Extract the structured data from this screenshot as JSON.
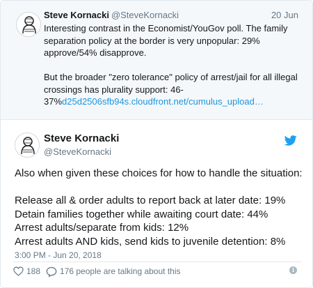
{
  "quoted_tweet": {
    "name": "Steve Kornacki",
    "handle": "@SteveKornacki",
    "date": "20 Jun",
    "text": "Interesting contrast in the Economist/YouGov poll. The family separation policy at the border is very unpopular: 29% approve/54% disapprove.\n\nBut the broader \"zero tolerance\" policy of arrest/jail for all illegal crossings has plurality support: 46-37%",
    "link": "d25d2506sfb94s.cloudfront.net/cumulus_upload…",
    "avatar_icon": "sketch-portrait-icon"
  },
  "main_tweet": {
    "name": "Steve Kornacki",
    "handle": "@SteveKornacki",
    "text": "Also when given these choices for how to handle the situation:\n\nRelease all & order adults to report back at later date: 19%\nDetain families together while awaiting court date: 44%\nArrest adults/separate from kids: 12%\nArrest adults AND kids, send kids to juvenile detention: 8%",
    "timestamp": "3:00 PM - Jun 20, 2018",
    "avatar_icon": "sketch-portrait-icon",
    "brand_icon": "twitter-bird-icon"
  },
  "actions": {
    "like_count": "188",
    "talking_text": "176 people are talking about this",
    "like_icon": "heart-icon",
    "reply_icon": "speech-bubble-icon",
    "info_icon": "info-icon"
  },
  "colors": {
    "link": "#1b95e0",
    "secondary_text": "#657786",
    "quoted_bg": "#f5f8fa",
    "border": "#e1e8ed",
    "brand": "#1da1f2"
  }
}
